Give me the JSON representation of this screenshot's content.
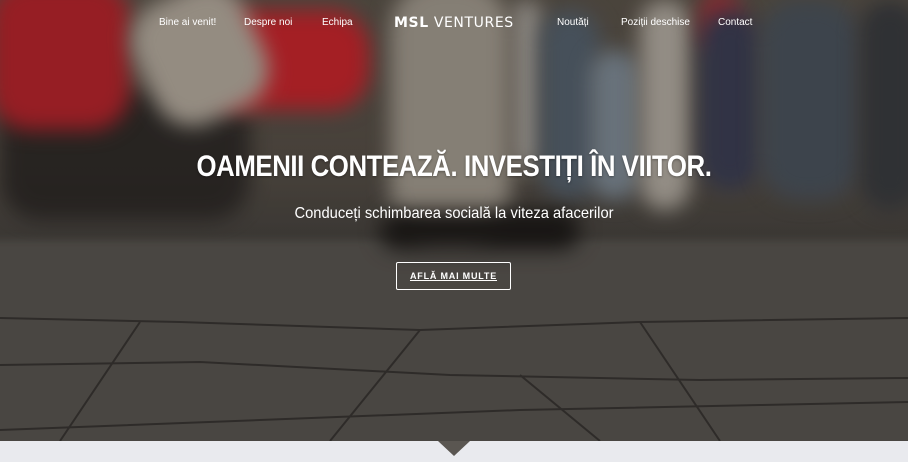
{
  "nav": {
    "items": [
      {
        "label": "Bine ai venit!"
      },
      {
        "label": "Despre noi"
      },
      {
        "label": "Echipa"
      },
      {
        "label": "Noutăți"
      },
      {
        "label": "Poziții deschise"
      },
      {
        "label": "Contact"
      }
    ],
    "logo": {
      "bold": "MSL",
      "rest": "VENTURES"
    }
  },
  "hero": {
    "headline": "OAMENII CONTEAZĂ. INVESTIȚI ÎN VIITOR.",
    "subhead": "Conduceți schimbarea socială la viteza afacerilor",
    "cta_label": "AFLĂ MAI MULTE"
  },
  "icons": {
    "scroll_indicator": "chevron-down-icon"
  },
  "colors": {
    "text": "#ffffff",
    "band": "#e9eaee"
  }
}
